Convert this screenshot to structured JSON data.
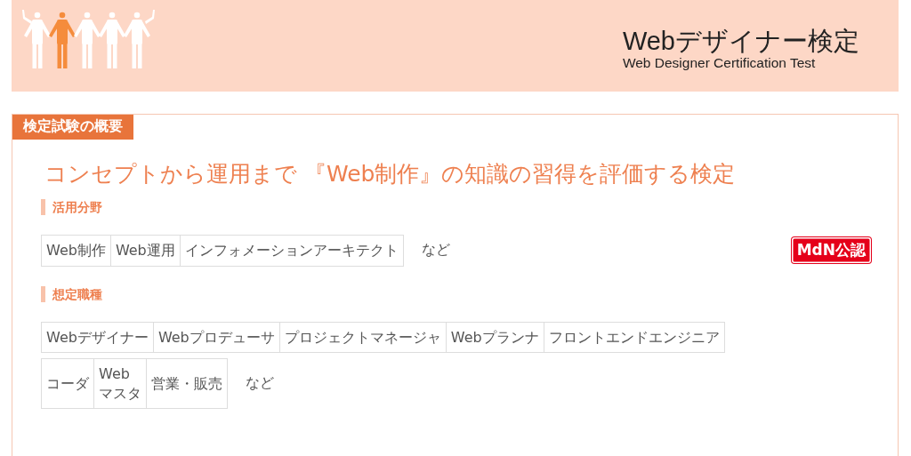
{
  "header": {
    "title": "Webデザイナー検定",
    "subtitle": "Web Designer Certification Test"
  },
  "panel": {
    "tab": "検定試験の概要",
    "headline": "コンセプトから運用まで 『Web制作』の知識の習得を評価する検定",
    "badge": "MdN公認",
    "sections": [
      {
        "heading": "活用分野",
        "tag_strips": [
          {
            "tags": [
              "Web制作",
              "Web運用",
              "インフォメーションアーキテクト"
            ]
          }
        ],
        "suffix": "など"
      },
      {
        "heading": "想定職種",
        "tag_strips": [
          {
            "tags": [
              "Webデザイナー",
              "Webプロデューサ",
              "プロジェクトマネージャ",
              "Webプランナ",
              "フロントエンドエンジニア"
            ]
          },
          {
            "tags": [
              "コーダ",
              "Web\nマスタ",
              "営業・販売"
            ]
          }
        ],
        "suffix": "など"
      }
    ]
  }
}
